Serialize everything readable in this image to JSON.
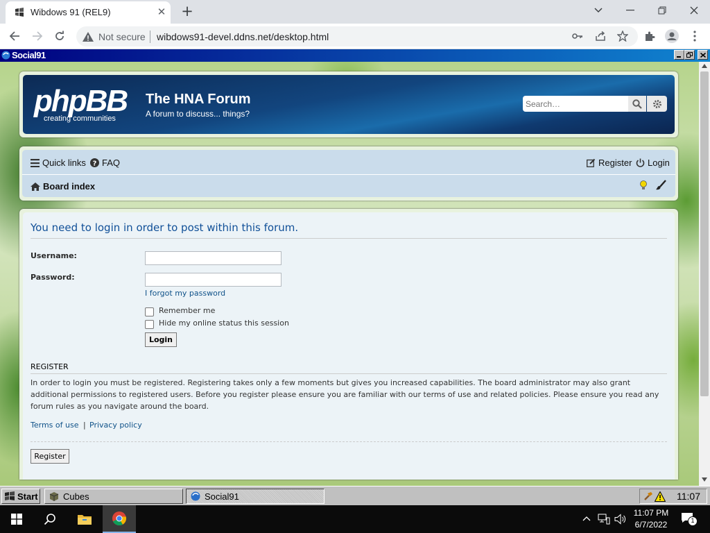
{
  "browser": {
    "tab_title": "Wibdows 91 (REL9)",
    "security_label": "Not secure",
    "url": "wibdows91-devel.ddns.net/desktop.html"
  },
  "inner_window": {
    "title": "Social91"
  },
  "forum": {
    "logo_text": "phpBB",
    "logo_tagline": "creating  communities",
    "site_title": "The HNA Forum",
    "site_description": "A forum to discuss... things?",
    "search_placeholder": "Search…",
    "nav": {
      "quick_links": "Quick links",
      "faq": "FAQ",
      "register": "Register",
      "login": "Login",
      "board_index": "Board index"
    },
    "login_form": {
      "title": "You need to login in order to post within this forum.",
      "username_label": "Username:",
      "username_value": "",
      "password_label": "Password:",
      "password_value": "",
      "forgot_password": "I forgot my password",
      "remember_me": "Remember me",
      "hide_status": "Hide my online status this session",
      "login_button": "Login"
    },
    "register_section": {
      "heading": "REGISTER",
      "text": "In order to login you must be registered. Registering takes only a few moments but gives you increased capabilities. The board administrator may also grant additional permissions to registered users. Before you register please ensure you are familiar with our terms of use and related policies. Please ensure you read any forum rules as you navigate around the board.",
      "terms_link": "Terms of use",
      "separator": "|",
      "privacy_link": "Privacy policy",
      "register_button": "Register"
    }
  },
  "w9_taskbar": {
    "start_label": "Start",
    "tasks": [
      {
        "label": "Cubes",
        "active": false
      },
      {
        "label": "Social91",
        "active": true
      }
    ],
    "clock": "11:07"
  },
  "w10_taskbar": {
    "time": "11:07 PM",
    "date": "6/7/2022",
    "notification_count": "1"
  },
  "colors": {
    "phpbb_header": "#12457e",
    "link": "#105289",
    "win9x_title": "#000080",
    "win9x_face": "#c0c0c0"
  }
}
